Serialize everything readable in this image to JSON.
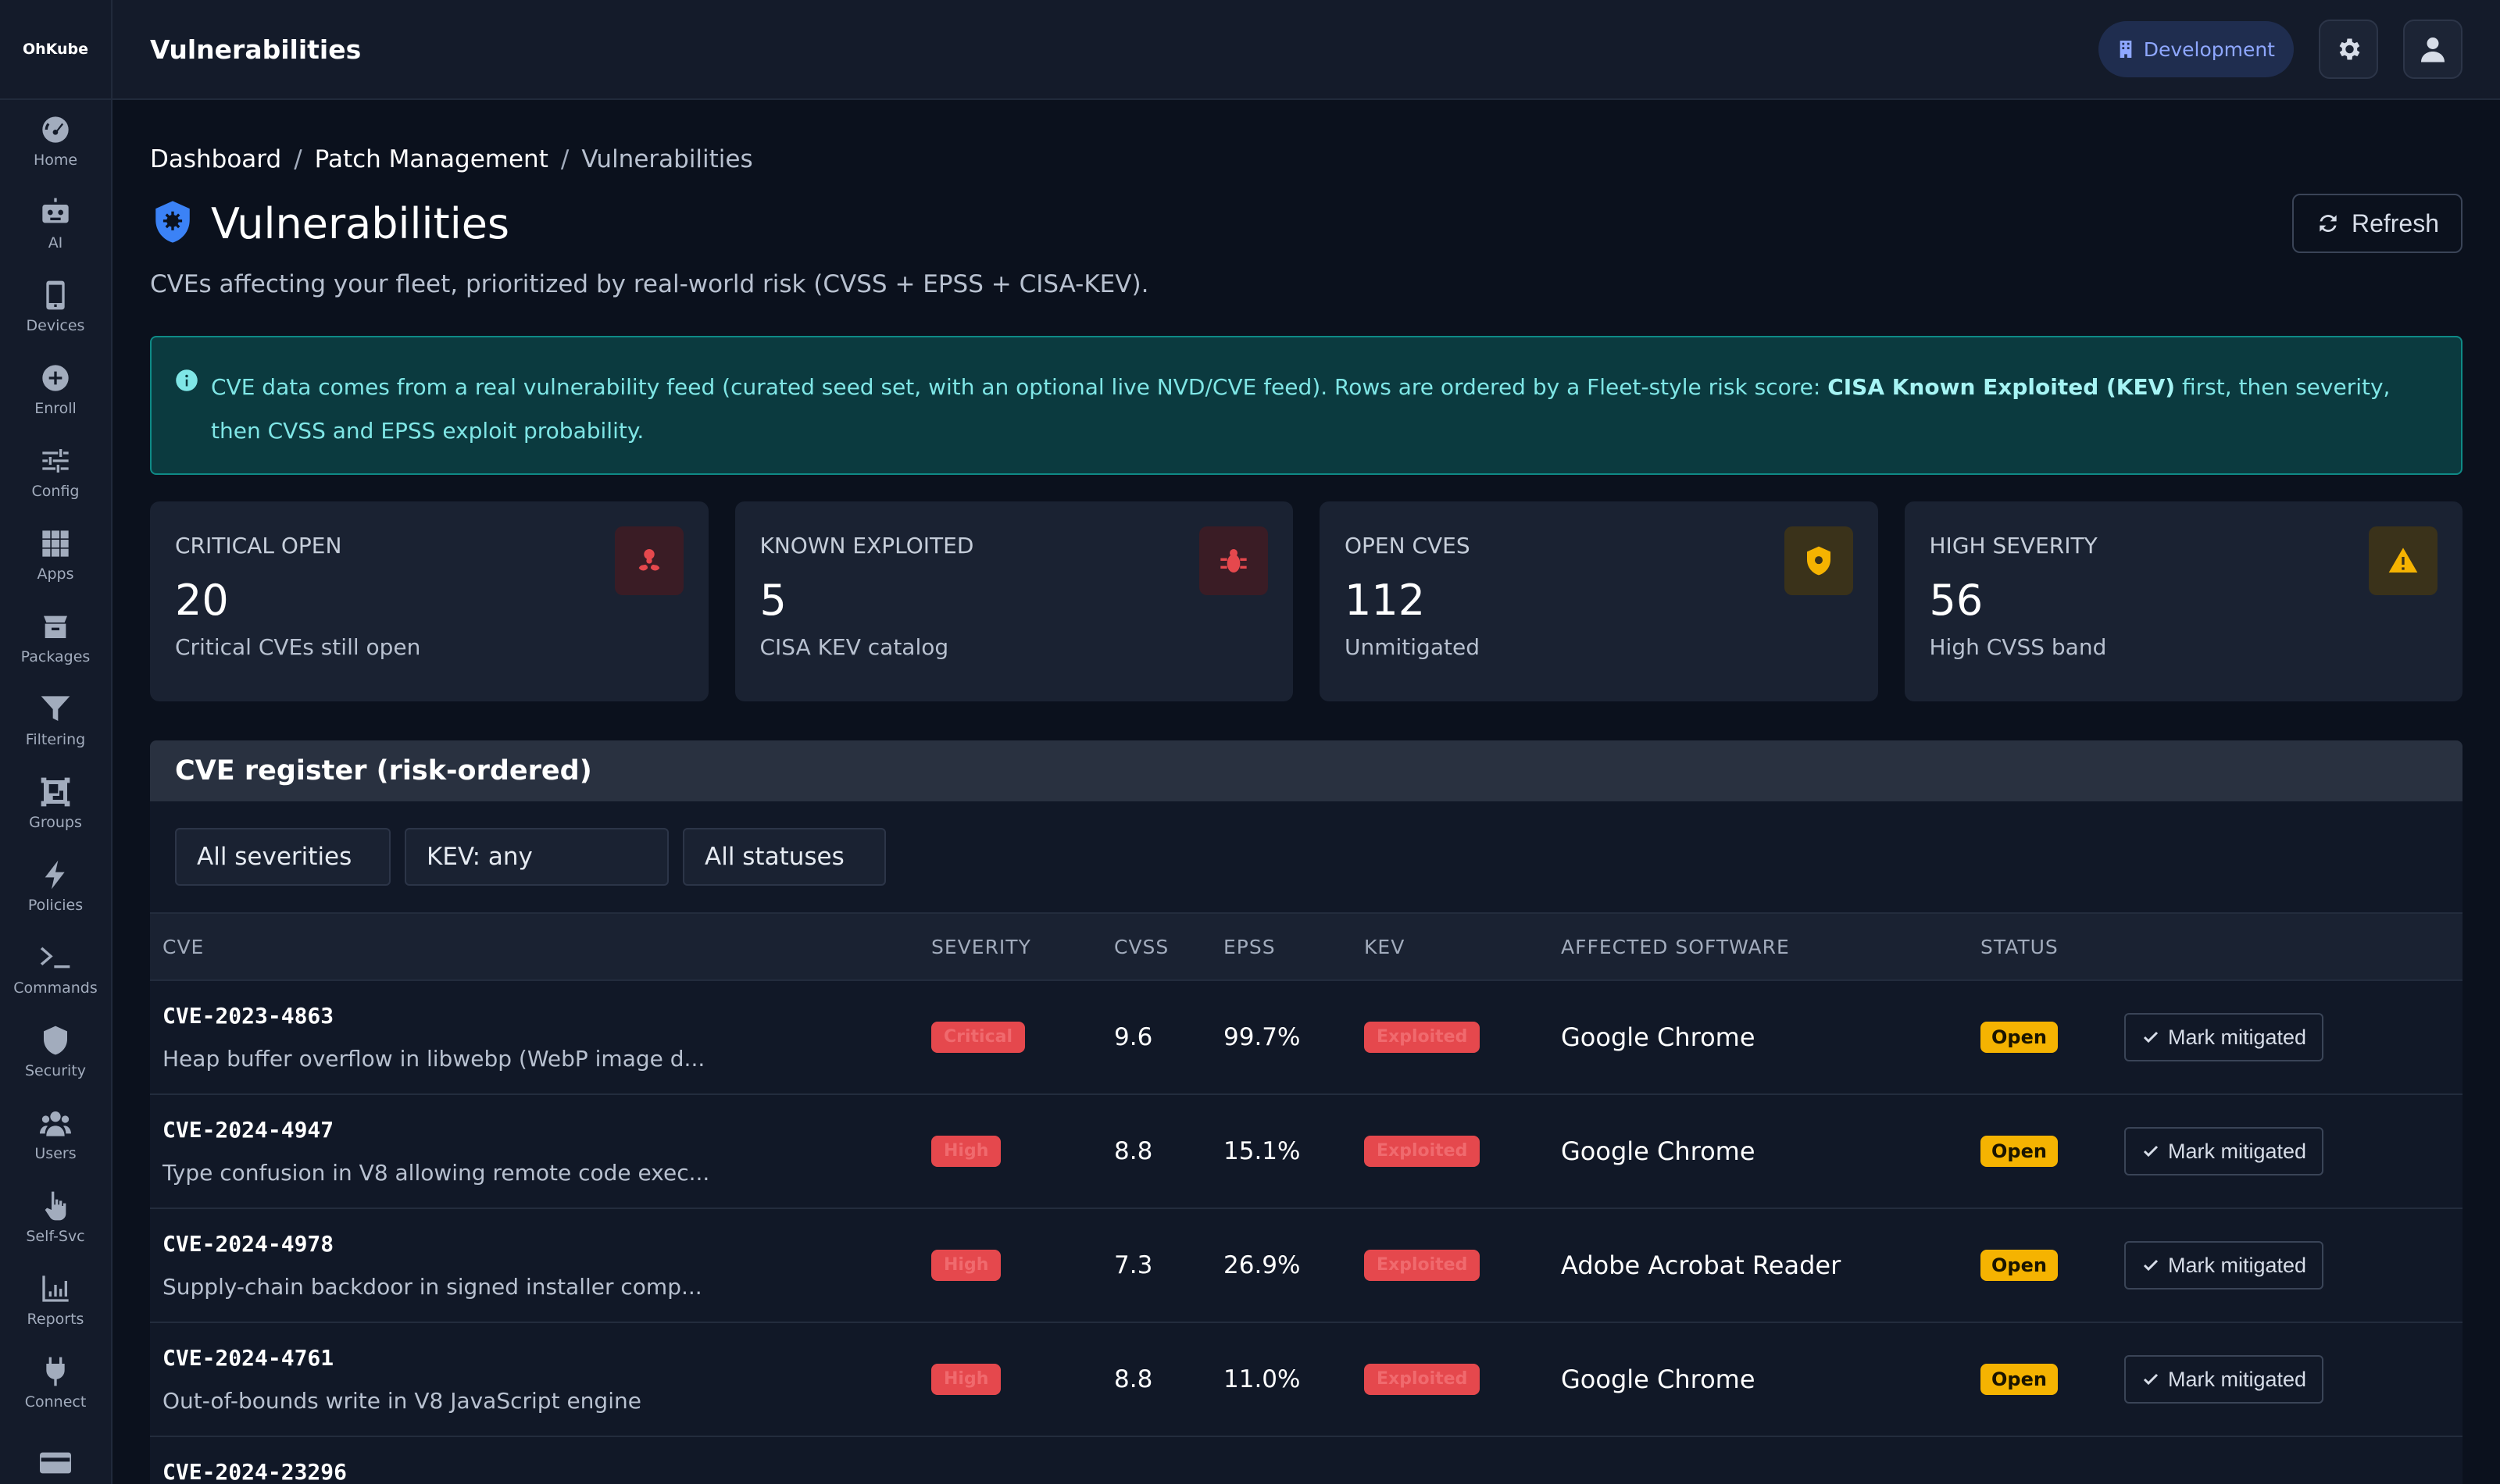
{
  "brand": "OhKube",
  "topbar": {
    "title": "Vulnerabilities",
    "environment": "Development"
  },
  "sidebar": {
    "items": [
      {
        "label": "Home",
        "icon": "gauge-icon"
      },
      {
        "label": "AI",
        "icon": "robot-icon"
      },
      {
        "label": "Devices",
        "icon": "phone-icon"
      },
      {
        "label": "Enroll",
        "icon": "plus-circle-icon"
      },
      {
        "label": "Config",
        "icon": "sliders-icon"
      },
      {
        "label": "Apps",
        "icon": "grid-icon"
      },
      {
        "label": "Packages",
        "icon": "box-icon"
      },
      {
        "label": "Filtering",
        "icon": "funnel-icon"
      },
      {
        "label": "Groups",
        "icon": "object-group-icon"
      },
      {
        "label": "Policies",
        "icon": "bolt-icon"
      },
      {
        "label": "Commands",
        "icon": "terminal-icon"
      },
      {
        "label": "Security",
        "icon": "shield-icon"
      },
      {
        "label": "Users",
        "icon": "users-icon"
      },
      {
        "label": "Self-Svc",
        "icon": "hand-pointer-icon"
      },
      {
        "label": "Reports",
        "icon": "chart-icon"
      },
      {
        "label": "Connect",
        "icon": "plug-icon"
      },
      {
        "label": "",
        "icon": "card-icon"
      }
    ]
  },
  "breadcrumb": {
    "items": [
      "Dashboard",
      "Patch Management"
    ],
    "current": "Vulnerabilities"
  },
  "page": {
    "title": "Vulnerabilities",
    "subtitle": "CVEs affecting your fleet, prioritized by real-world risk (CVSS + EPSS + CISA-KEV).",
    "refresh_label": "Refresh"
  },
  "alert": {
    "text_before": "CVE data comes from a real vulnerability feed (curated seed set, with an optional live NVD/CVE feed). Rows are ordered by a Fleet-style risk score: ",
    "text_bold": "CISA Known Exploited (KEV)",
    "text_after": " first, then severity, then CVSS and EPSS exploit probability."
  },
  "stats": [
    {
      "label": "CRITICAL OPEN",
      "value": "20",
      "caption": "Critical CVEs still open",
      "icon": "biohazard-icon",
      "color": "#e5484d"
    },
    {
      "label": "KNOWN EXPLOITED",
      "value": "5",
      "caption": "CISA KEV catalog",
      "icon": "bug-icon",
      "color": "#e5484d"
    },
    {
      "label": "OPEN CVES",
      "value": "112",
      "caption": "Unmitigated",
      "icon": "shield-virus-icon",
      "color": "#f5b301"
    },
    {
      "label": "HIGH SEVERITY",
      "value": "56",
      "caption": "High CVSS band",
      "icon": "warning-icon",
      "color": "#f5b301"
    }
  ],
  "register": {
    "title": "CVE register (risk-ordered)",
    "filters": [
      "All severities",
      "KEV: any",
      "All statuses"
    ],
    "columns": [
      "CVE",
      "SEVERITY",
      "CVSS",
      "EPSS",
      "KEV",
      "AFFECTED SOFTWARE",
      "STATUS",
      ""
    ],
    "action_label": "Mark mitigated",
    "rows": [
      {
        "cve": "CVE-2023-4863",
        "desc": "Heap buffer overflow in libwebp (WebP image d...",
        "severity": "Critical",
        "cvss": "9.6",
        "epss": "99.7%",
        "kev": "Exploited",
        "software": "Google Chrome",
        "status": "Open"
      },
      {
        "cve": "CVE-2024-4947",
        "desc": "Type confusion in V8 allowing remote code exec...",
        "severity": "High",
        "cvss": "8.8",
        "epss": "15.1%",
        "kev": "Exploited",
        "software": "Google Chrome",
        "status": "Open"
      },
      {
        "cve": "CVE-2024-4978",
        "desc": "Supply-chain backdoor in signed installer comp...",
        "severity": "High",
        "cvss": "7.3",
        "epss": "26.9%",
        "kev": "Exploited",
        "software": "Adobe Acrobat Reader",
        "status": "Open"
      },
      {
        "cve": "CVE-2024-4761",
        "desc": "Out-of-bounds write in V8 JavaScript engine",
        "severity": "High",
        "cvss": "8.8",
        "epss": "11.0%",
        "kev": "Exploited",
        "software": "Google Chrome",
        "status": "Open"
      }
    ],
    "partial_row": {
      "cve": "CVE-2024-23296"
    }
  }
}
